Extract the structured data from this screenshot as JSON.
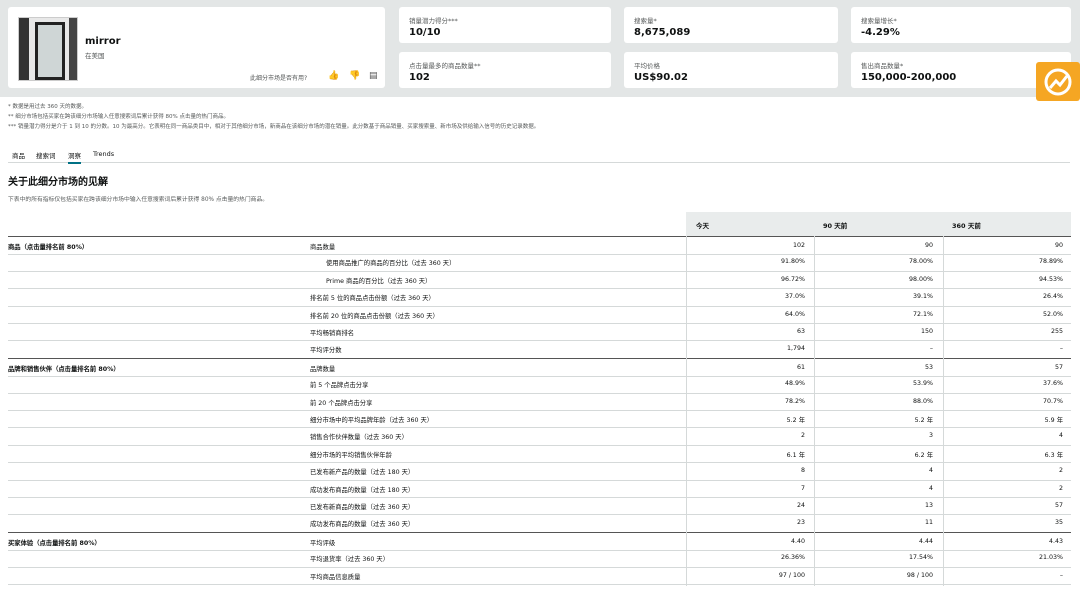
{
  "product": {
    "name": "mirror",
    "subtitle": "在美国",
    "feedback_question": "此细分市场是否有用?",
    "icons": [
      "thumbs-up-icon",
      "thumbs-down-icon",
      "comment-icon"
    ]
  },
  "metrics": [
    {
      "label": "销量潜力得分***",
      "value": "10/10"
    },
    {
      "label": "搜索量*",
      "value": "8,675,089"
    },
    {
      "label": "搜索量增长*",
      "value": "-4.29%"
    },
    {
      "label": "点击量最多的商品数量**",
      "value": "102"
    },
    {
      "label": "平均价格",
      "value": "US$90.02"
    },
    {
      "label": "售出商品数量*",
      "value": "150,000-200,000"
    }
  ],
  "notes": [
    "* 数据是用过去 360 天的数据。",
    "** 细分市场包括买家在跨该细分市场输入任意搜索词后累计获得 80% 点击量的热门商品。",
    "*** 销量潜力得分是介于 1 到 10 的分数。10 为最高分。它表明在同一商品类目中，相对于其他细分市场，新商品在该细分市场的潜在销量。此分数基于商品销量、买家搜索量、新市场及供给输入信号的历史记录数据。"
  ],
  "tabs": [
    "商品",
    "搜索词",
    "洞察",
    "Trends"
  ],
  "active_tab": 2,
  "section": {
    "title": "关于此细分市场的见解",
    "subtitle": "下表中的所有指标仅包括买家在跨该细分市场中输入任意搜索词后累计获得 80% 点击量的热门商品。"
  },
  "columns": [
    "今天",
    "90 天前",
    "360 天前"
  ],
  "rows": [
    {
      "group": "商品（点击量排名前 80%）",
      "metric": "商品数量",
      "indent": false,
      "v": [
        "102",
        "90",
        "90"
      ]
    },
    {
      "group": "",
      "metric": "使用商品推广的商品的百分比（过去 360 天）",
      "indent": true,
      "v": [
        "91.80%",
        "78.00%",
        "78.89%"
      ]
    },
    {
      "group": "",
      "metric": "Prime 商品的百分比（过去 360 天）",
      "indent": true,
      "v": [
        "96.72%",
        "98.00%",
        "94.53%"
      ]
    },
    {
      "group": "",
      "metric": "排名前 5 位的商品点击份额（过去 360 天）",
      "indent": false,
      "v": [
        "37.0%",
        "39.1%",
        "26.4%"
      ]
    },
    {
      "group": "",
      "metric": "排名前 20 位的商品点击份额（过去 360 天）",
      "indent": false,
      "v": [
        "64.0%",
        "72.1%",
        "52.0%"
      ]
    },
    {
      "group": "",
      "metric": "平均畅销商排名",
      "indent": false,
      "v": [
        "63",
        "150",
        "255"
      ]
    },
    {
      "group": "",
      "metric": "平均评分数",
      "indent": false,
      "v": [
        "1,794",
        "–",
        "–"
      ]
    },
    {
      "group": "品牌和销售伙伴（点击量排名前 80%）",
      "metric": "品牌数量",
      "indent": false,
      "v": [
        "61",
        "53",
        "57"
      ]
    },
    {
      "group": "",
      "metric": "前 5 个品牌点击分享",
      "indent": false,
      "v": [
        "48.9%",
        "53.9%",
        "37.6%"
      ]
    },
    {
      "group": "",
      "metric": "前 20 个品牌点击分享",
      "indent": false,
      "v": [
        "78.2%",
        "88.0%",
        "70.7%"
      ]
    },
    {
      "group": "",
      "metric": "细分市场中的平均品牌年龄（过去 360 天）",
      "indent": false,
      "v": [
        "5.2 年",
        "5.2 年",
        "5.9 年"
      ]
    },
    {
      "group": "",
      "metric": "销售合作伙伴数量（过去 360 天）",
      "indent": false,
      "v": [
        "2",
        "3",
        "4"
      ]
    },
    {
      "group": "",
      "metric": "细分市场的平均销售伙伴年龄",
      "indent": false,
      "v": [
        "6.1 年",
        "6.2 年",
        "6.3 年"
      ]
    },
    {
      "group": "",
      "metric": "已发布新产品的数量（过去 180 天）",
      "indent": false,
      "v": [
        "8",
        "4",
        "2"
      ]
    },
    {
      "group": "",
      "metric": "成功发布商品的数量（过去 180 天）",
      "indent": false,
      "v": [
        "7",
        "4",
        "2"
      ]
    },
    {
      "group": "",
      "metric": "已发布新商品的数量（过去 360 天）",
      "indent": false,
      "v": [
        "24",
        "13",
        "57"
      ]
    },
    {
      "group": "",
      "metric": "成功发布商品的数量（过去 360 天）",
      "indent": false,
      "v": [
        "23",
        "11",
        "35"
      ]
    },
    {
      "group": "买家体验（点击量排名前 80%）",
      "metric": "平均评级",
      "indent": false,
      "v": [
        "4.40",
        "4.44",
        "4.43"
      ]
    },
    {
      "group": "",
      "metric": "平均退货率（过去 360 天）",
      "indent": false,
      "v": [
        "26.36%",
        "17.54%",
        "21.03%"
      ]
    },
    {
      "group": "",
      "metric": "平均商品信息质量",
      "indent": false,
      "v": [
        "97 / 100",
        "98 / 100",
        "–"
      ]
    }
  ],
  "colors": {
    "accent": "#007185",
    "logo": "#f5a623",
    "header_bg": "#e3e6e6"
  }
}
